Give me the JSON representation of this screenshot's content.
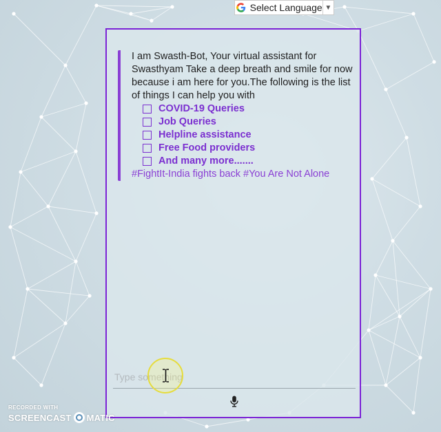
{
  "translate": {
    "label": "Select Language",
    "arrow": "▼"
  },
  "chat": {
    "bot_message": "I am Swasth-Bot, Your virtual assistant for Swasthyam Take a deep breath and smile for now because i am here for you.The following is the list of things I can help you with",
    "options": [
      "COVID-19 Queries",
      "Job Queries",
      "Helpline assistance",
      "Free Food providers",
      "And many more......."
    ],
    "hashtags": "#FightIt-India fights back #You Are Not Alone",
    "input_placeholder": "Type something",
    "input_value": ""
  },
  "watermark": {
    "recorded_with": "RECORDED WITH",
    "brand_left": "SCREENCAST",
    "brand_right": "MATIC"
  },
  "colors": {
    "accent": "#7b22d6",
    "option_text": "#7b2fd0",
    "hashtag": "#8a3fd4",
    "cursor_halo": "#e6dc3c"
  },
  "icons": [
    "google-g-icon",
    "dropdown-arrow-icon",
    "checkbox-icon",
    "microphone-icon",
    "text-cursor-icon",
    "screencast-o-icon"
  ]
}
